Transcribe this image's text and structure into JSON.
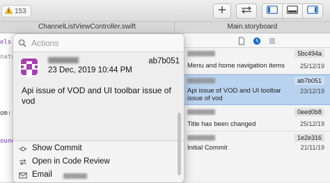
{
  "toolbar": {
    "warning_count": "153",
    "buttons": [
      "add-icon",
      "swap-arrows-icon",
      "editor-standard-icon",
      "editor-bottom-panel-icon",
      "inspector-panel-icon"
    ]
  },
  "tabs": [
    {
      "label": "ChannelListViewController.swift"
    },
    {
      "label": "Main.storyboard"
    }
  ],
  "editor_fragments": [
    "els:a",
    "natch",
    "om:",
    "ound"
  ],
  "popover": {
    "search_placeholder": "Actions",
    "commit": {
      "hash": "ab7b051",
      "date": "23 Dec, 2019 10:44 PM",
      "message": "Api issue of VOD and  UI toolbar issue of vod"
    },
    "actions": [
      {
        "label": "Show Commit",
        "icon": "commit-icon"
      },
      {
        "label": "Open in Code Review",
        "icon": "code-review-icon"
      },
      {
        "label": "Email",
        "icon": "envelope-icon"
      }
    ]
  },
  "blame": {
    "entries": [
      {
        "hash": "5bc494a",
        "message": "Menu and home navigation items",
        "date": "25/12/19",
        "selected": false
      },
      {
        "hash": "ab7b051",
        "message": "Api issue of VOD and  UI toolbar issue of vod",
        "date": "23/12/19",
        "selected": true
      },
      {
        "hash": "0eed0b8",
        "message": "Title has been changed",
        "date": "25/12/19",
        "selected": false
      },
      {
        "hash": "1e2e316",
        "message": "Initial Commit",
        "date": "21/11/19",
        "selected": false
      }
    ]
  },
  "colors": {
    "selection": "#b9d2ef",
    "accent": "#1f6fd1",
    "avatar": "#a83fb0"
  }
}
